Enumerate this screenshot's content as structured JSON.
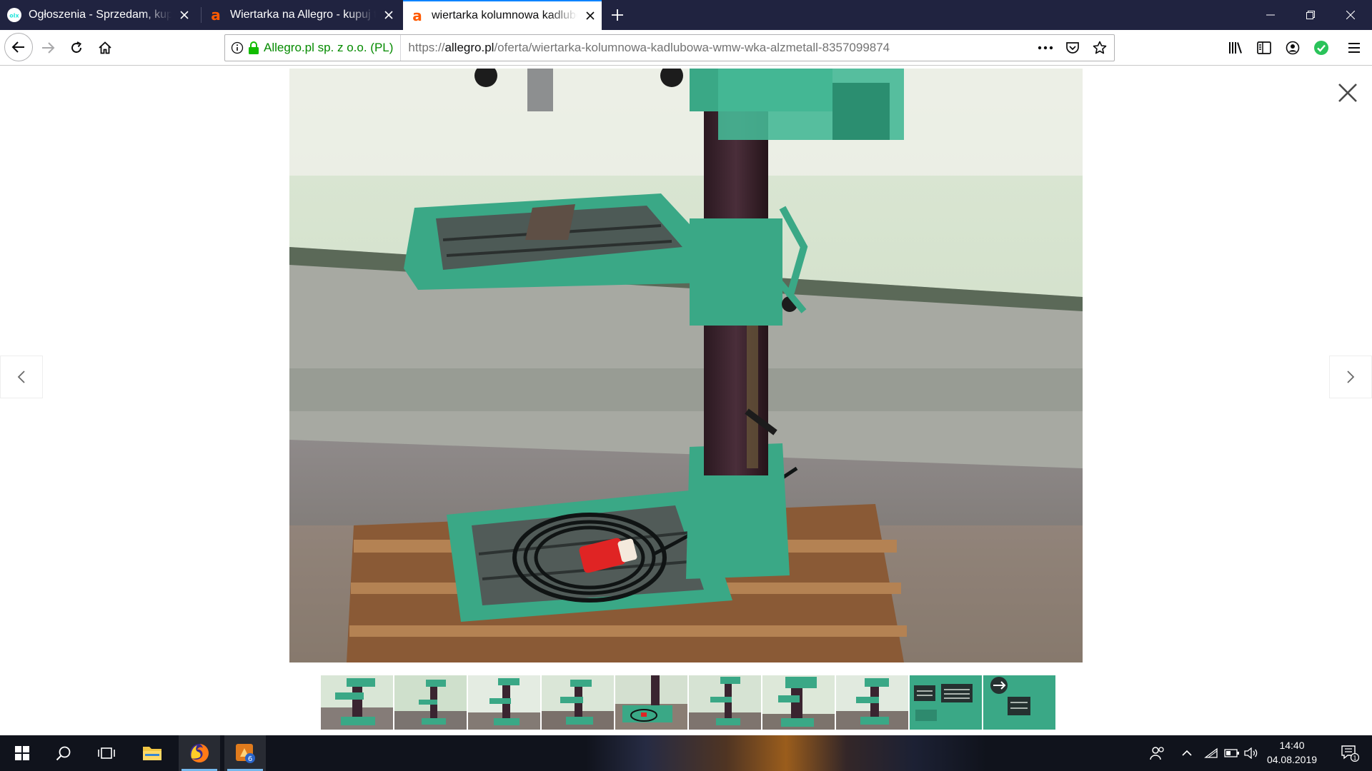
{
  "browser": {
    "tabs": [
      {
        "title": "Ogłoszenia - Sprzedam, kupię na OLX.pl",
        "favicon": "olx-favicon",
        "active": false
      },
      {
        "title": "Wiertarka na Allegro - kupuj tanio",
        "favicon": "allegro-favicon",
        "active": false
      },
      {
        "title": "wiertarka kolumnowa kadlubowa WMW WKA Alzmetall",
        "favicon": "allegro-favicon",
        "active": true
      }
    ],
    "new_tab_icon": "plus-icon",
    "window_controls": [
      "minimize-icon",
      "restore-icon",
      "close-icon"
    ]
  },
  "navbar": {
    "identity_label": "Allegro.pl sp. z o.o. (PL)",
    "url_prefix": "https://",
    "url_host": "allegro.pl",
    "url_path": "/oferta/wiertarka-kolumnowa-kadlubowa-wmw-wka-alzmetall-8357099874",
    "icons": [
      "back-arrow-icon",
      "forward-arrow-icon",
      "reload-icon",
      "home-icon",
      "info-icon",
      "lock-icon",
      "page-actions-icon",
      "pocket-icon",
      "bookmark-star-icon",
      "library-icon",
      "sidebar-icon",
      "account-icon",
      "extension-check-icon",
      "hamburger-menu-icon"
    ]
  },
  "lightbox": {
    "thumbnail_count": 10,
    "thumbnail_labels": [
      "",
      "",
      "",
      "",
      "",
      "",
      "",
      "",
      "",
      ""
    ],
    "icons": [
      "close-x-icon",
      "chevron-left-icon",
      "chevron-right-icon"
    ]
  },
  "taskbar": {
    "clock_time": "14:40",
    "clock_date": "04.08.2019",
    "badge_count": "6",
    "notification_count": "1",
    "icons": [
      "windows-start-icon",
      "search-icon",
      "task-view-icon",
      "file-explorer-icon",
      "firefox-icon",
      "app-badge-icon",
      "people-icon",
      "chevron-up-icon",
      "wifi-icon",
      "battery-icon",
      "volume-icon",
      "action-center-icon"
    ]
  },
  "colors": {
    "tabbar_bg": "#202340",
    "active_tab_accent": "#0a84ff",
    "secure_green": "#058b00",
    "allegro_orange": "#ff5a00",
    "taskbar_bg": "#10131c",
    "machine_green": "#3aa886"
  }
}
